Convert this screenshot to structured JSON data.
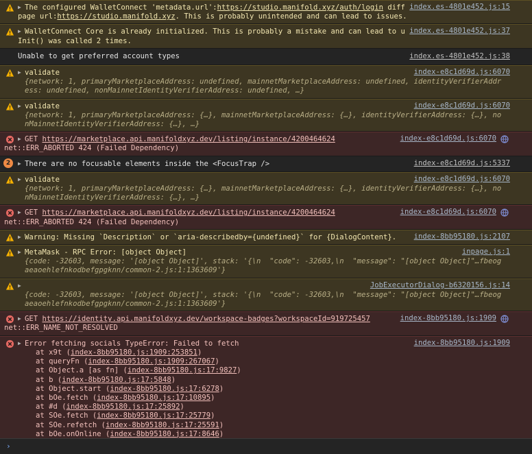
{
  "messages": {
    "m1": {
      "pre": "The configured WalletConnect 'metadata.url':",
      "url1": "https://studio.manifold.xyz/auth/login",
      "mid": " differs from the actual page url:",
      "url2": "https://studio.manifold.xyz",
      "post": ". This is probably unintended and can lead to issues.",
      "src": "index.es-4801e452.js:15"
    },
    "m2": {
      "text": "WalletConnect Core is already initialized. This is probably a mistake and can lead to unexpected behavior. Init() was called 2 times.",
      "src": "index.es-4801e452.js:37"
    },
    "m3": {
      "text": "Unable to get preferred account types",
      "src": "index.es-4801e452.js:38"
    },
    "m4": {
      "label": "validate",
      "src": "index-e8c1d69d.js:6070",
      "obj": "{network: 1, primaryMarketplaceAddress: undefined, mainnetMarketplaceAddress: undefined, identityVerifierAddress: undefined, nonMainnetIdentityVerifierAddress: undefined, …}"
    },
    "m5": {
      "label": "validate",
      "src": "index-e8c1d69d.js:6070",
      "obj": "{network: 1, primaryMarketplaceAddress: {…}, mainnetMarketplaceAddress: {…}, identityVerifierAddress: {…}, nonMainnetIdentityVerifierAddress: {…}, …}"
    },
    "m6": {
      "method": "GET ",
      "url": "https://marketplace.api.manifoldxyz.dev/listing/instance/4200464624",
      "status": "net::ERR_ABORTED 424 (Failed Dependency)",
      "src": "index-e8c1d69d.js:6070"
    },
    "m7": {
      "count": "2",
      "text": "There are no focusable elements inside the <FocusTrap />",
      "src": "index-e8c1d69d.js:5337"
    },
    "m8": {
      "label": "validate",
      "src": "index-e8c1d69d.js:6070",
      "obj": "{network: 1, primaryMarketplaceAddress: {…}, mainnetMarketplaceAddress: {…}, identityVerifierAddress: {…}, nonMainnetIdentityVerifierAddress: {…}, …}"
    },
    "m9": {
      "method": "GET ",
      "url": "https://marketplace.api.manifoldxyz.dev/listing/instance/4200464624",
      "status": "net::ERR_ABORTED 424 (Failed Dependency)",
      "src": "index-e8c1d69d.js:6070"
    },
    "m10": {
      "text": "Warning: Missing `Description` or `aria-describedby={undefined}` for {DialogContent}.",
      "src": "index-8bb95180.js:2107"
    },
    "m11": {
      "label": "MetaMask - RPC Error: [object Object]",
      "src": "inpage.js:1",
      "obj": "{code: -32603, message: '[object Object]', stack: '{\\n  \"code\": -32603,\\n  \"message\": \"[object Object]\"…fbeogaeaoehlefnkodbefgpgknn/common-2.js:1:1363609'}"
    },
    "m12": {
      "src": "JobExecutorDialog-b6320156.js:14",
      "obj": "{code: -32603, message: '[object Object]', stack: '{\\n  \"code\": -32603,\\n  \"message\": \"[object Object]\"…fbeogaeaoehlefnkodbefgpgknn/common-2.js:1:1363609'}"
    },
    "m13": {
      "method": "GET ",
      "url": "https://identity.api.manifoldxyz.dev/workspace-badges?workspaceId=919725457",
      "status": "net::ERR_NAME_NOT_RESOLVED",
      "src": "index-8bb95180.js:1909"
    },
    "m14": {
      "text": "Error fetching socials TypeError: Failed to fetch",
      "src": "index-8bb95180.js:1909",
      "stack": [
        {
          "fn": "at x9t (",
          "loc": "index-8bb95180.js:1909:253851",
          "end": ")"
        },
        {
          "fn": "at queryFn (",
          "loc": "index-8bb95180.js:1909:267067",
          "end": ")"
        },
        {
          "fn": "at Object.a [as fn] (",
          "loc": "index-8bb95180.js:17:9827",
          "end": ")"
        },
        {
          "fn": "at b (",
          "loc": "index-8bb95180.js:17:5848",
          "end": ")"
        },
        {
          "fn": "at Object.start (",
          "loc": "index-8bb95180.js:17:6278",
          "end": ")"
        },
        {
          "fn": "at bOe.fetch (",
          "loc": "index-8bb95180.js:17:10895",
          "end": ")"
        },
        {
          "fn": "at #d (",
          "loc": "index-8bb95180.js:17:25892",
          "end": ")"
        },
        {
          "fn": "at SOe.fetch (",
          "loc": "index-8bb95180.js:17:25779",
          "end": ")"
        },
        {
          "fn": "at SOe.refetch (",
          "loc": "index-8bb95180.js:17:25591",
          "end": ")"
        },
        {
          "fn": "at bOe.onOnline (",
          "loc": "index-8bb95180.js:17:8646",
          "end": ")"
        }
      ]
    }
  },
  "prompt": {
    "chevron": "›"
  },
  "colors": {
    "warn_bg": "#3d3622",
    "err_bg": "#3d2626",
    "warn_icon": "#f6b100",
    "err_icon": "#e46962",
    "page_bg": "#242424"
  }
}
